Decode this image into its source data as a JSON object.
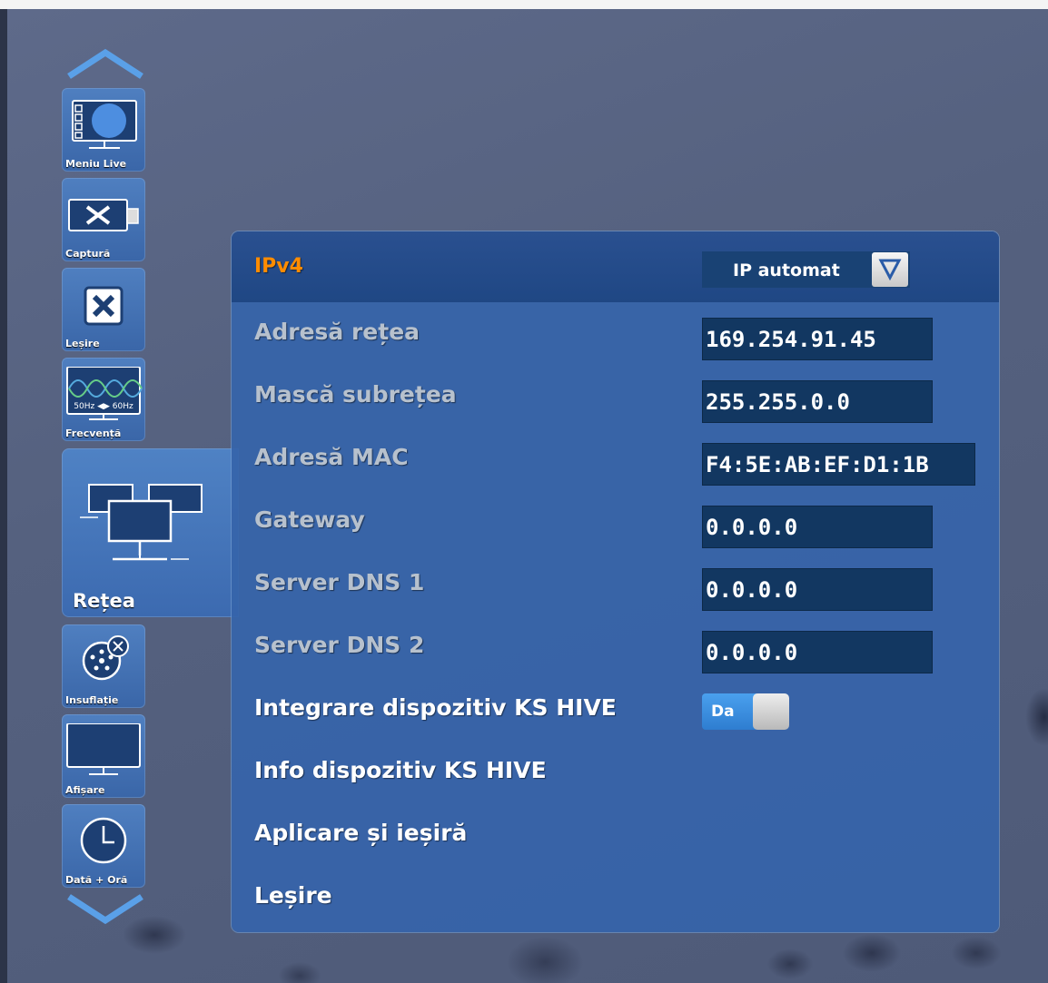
{
  "sidebar": {
    "items": [
      {
        "label": "Meniu Live",
        "icon": "monitor-menu-icon"
      },
      {
        "label": "Captură",
        "icon": "usb-tools-icon"
      },
      {
        "label": "Leșire",
        "icon": "exit-x-icon"
      },
      {
        "label": "Frecvență",
        "icon": "frequency-wave-icon",
        "icon_text": "50Hz ◀▶ 60Hz"
      },
      {
        "label": "Rețea",
        "icon": "network-icon",
        "active": true
      },
      {
        "label": "Insuflație",
        "icon": "insufflation-icon"
      },
      {
        "label": "Afișare",
        "icon": "display-icon"
      },
      {
        "label": "Dată + Oră",
        "icon": "clock-icon"
      }
    ]
  },
  "panel": {
    "header": {
      "label": "IPv4",
      "dropdown_value": "IP automat"
    },
    "rows": [
      {
        "label": "Adresă rețea",
        "value": "169.254.91.45"
      },
      {
        "label": "Mască subrețea",
        "value": "255.255.0.0"
      },
      {
        "label": "Adresă MAC",
        "value": "F4:5E:AB:EF:D1:1B"
      },
      {
        "label": "Gateway",
        "value": "0.0.0.0"
      },
      {
        "label": "Server DNS 1",
        "value": "0.0.0.0"
      },
      {
        "label": "Server DNS 2",
        "value": "0.0.0.0"
      }
    ],
    "toggle_row": {
      "label": "Integrare dispozitiv KS HIVE",
      "toggle_label": "Da"
    },
    "actions": [
      {
        "label": "Info dispozitiv KS HIVE"
      },
      {
        "label": "Aplicare și ieșiră"
      },
      {
        "label": "Leșire"
      }
    ]
  },
  "colors": {
    "accent": "#ff8c00",
    "panel": "#3664aa",
    "value_box": "#123761"
  }
}
